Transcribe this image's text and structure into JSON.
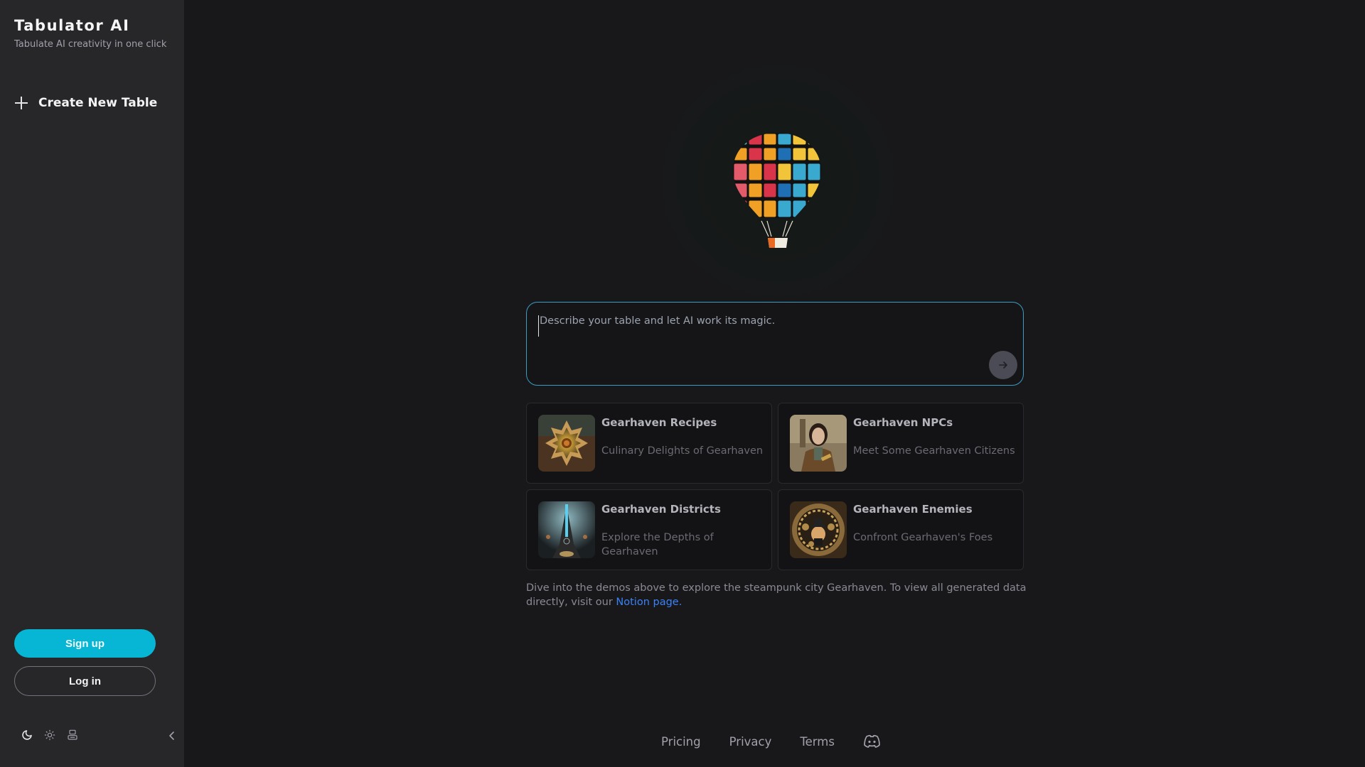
{
  "sidebar": {
    "title": "Tabulator AI",
    "subtitle": "Tabulate AI creativity in one click",
    "create_label": "Create New Table",
    "signup_label": "Sign up",
    "login_label": "Log in",
    "icons": [
      "moon-icon",
      "sun-icon",
      "system-theme-icon",
      "chevron-left-icon"
    ]
  },
  "prompt": {
    "placeholder": "Describe your table and let AI work its magic.",
    "value": ""
  },
  "cards": [
    {
      "title": "Gearhaven Recipes",
      "description": "Culinary Delights of Gearhaven",
      "thumb": "recipes-image"
    },
    {
      "title": "Gearhaven NPCs",
      "description": "Meet Some Gearhaven Citizens",
      "thumb": "npcs-image"
    },
    {
      "title": "Gearhaven Districts",
      "description": "Explore the Depths of Gearhaven",
      "thumb": "districts-image"
    },
    {
      "title": "Gearhaven Enemies",
      "description": "Confront Gearhaven's Foes",
      "thumb": "enemies-image"
    }
  ],
  "info": {
    "text": "Dive into the demos above to explore the steampunk city Gearhaven. To view all generated data directly, visit our ",
    "link_label": "Notion page."
  },
  "footer": {
    "links": [
      "Pricing",
      "Privacy",
      "Terms"
    ],
    "icon": "discord-icon"
  },
  "colors": {
    "accent": "#06b6d4",
    "link": "#3b82f6",
    "sidebar_bg": "#27272a",
    "main_bg": "#18181b"
  }
}
